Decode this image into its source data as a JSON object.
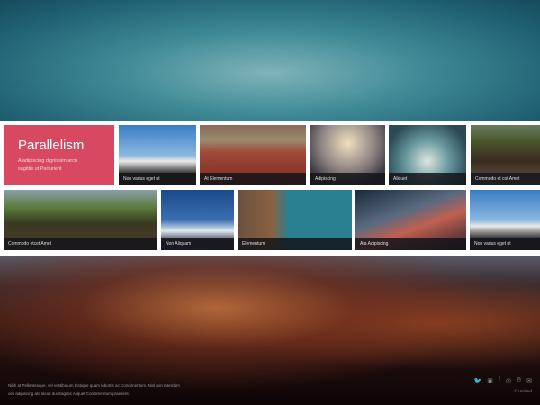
{
  "feature": {
    "title": "Parallelism",
    "text": "A adipiscing dignissim arcu sagittis ut Parturient",
    "color": "#d84860"
  },
  "row1": [
    {
      "caption": "Non varius eget ut",
      "bg": "linear-gradient(#3a7cc4 0%,#8ab8e0 50%,#e8e8e8 60%,#333 80%)"
    },
    {
      "caption": "At Elementum",
      "bg": "linear-gradient(#8a6a5a 0%,#9a8a70 25%,#a04a3a 45%,#7a2a20 100%)"
    },
    {
      "caption": "Adipiscing",
      "bg": "radial-gradient(circle at 50% 30%,#f0e0c0 0%,#8a8080 50%,#3a3a40 80%)"
    },
    {
      "caption": "Aliquet",
      "bg": "radial-gradient(circle at 50% 60%,#dde8e0 0%,#6a9aa0 40%,#2a4a55 80%)"
    },
    {
      "caption": "Commodo et cot Amet",
      "bg": "linear-gradient(#6a7a60 0%,#4a5a30 25%,#3a2a20 60%,#6a5a50 100%)"
    }
  ],
  "row2": [
    {
      "caption": "Commodo etcet Amet",
      "bg": "linear-gradient(#8aa0a8 0%,#5a7a3a 30%,#3a3a20 55%,#4a3a30 100%)"
    },
    {
      "caption": "Non Aliquam",
      "bg": "linear-gradient(#1a4a8a 0%,#3a70b0 50%,#e0e8f0 68%,#3a4050 85%)"
    },
    {
      "caption": "Elementum",
      "bg": "linear-gradient(90deg,#6a5040 0%,#8a6040 30%,#2a8090 45%,#2a8090 100%)"
    },
    {
      "caption": "Ata Adipiscing",
      "bg": "linear-gradient(160deg,#1a2a3a 0%,#5a6a80 40%,#c06050 60%,#2a2030 100%)"
    },
    {
      "caption": "Non varius eget ut",
      "bg": "linear-gradient(#3a7cc4 0%,#8ab8e0 50%,#e8e8e8 60%,#333 80%)"
    }
  ],
  "footer": {
    "text1": "Nibh at Pellentesque, vel vestibulum tristique quam lobortis ac Condimentum. Nisl non Interdum",
    "text2": "oeji adipiscing ata lacus dui Sagittis Aliquet Condimentum praesent.",
    "copyright": "© Untitled",
    "social": [
      {
        "name": "twitter-icon",
        "glyph": "🐦"
      },
      {
        "name": "instagram-icon",
        "glyph": "▣"
      },
      {
        "name": "facebook-icon",
        "glyph": "f"
      },
      {
        "name": "dribbble-icon",
        "glyph": "◎"
      },
      {
        "name": "pinterest-icon",
        "glyph": "℗"
      },
      {
        "name": "email-icon",
        "glyph": "✉"
      }
    ]
  }
}
